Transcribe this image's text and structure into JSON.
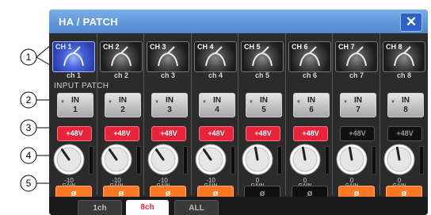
{
  "window": {
    "title": "HA / PATCH",
    "close_label": "✕"
  },
  "section_label": "INPUT PATCH",
  "callouts": [
    "1",
    "2",
    "3",
    "4",
    "5"
  ],
  "channels": [
    {
      "name": "CH 1",
      "sub": "ch 1",
      "patch_top": "IN",
      "patch_bottom": "1",
      "phantom": "+48V",
      "phantom_on": true,
      "gain": "-10",
      "gain_label": "GAIN",
      "phase": "ø",
      "phase_on": true,
      "selected": true
    },
    {
      "name": "CH 2",
      "sub": "ch 2",
      "patch_top": "IN",
      "patch_bottom": "2",
      "phantom": "+48V",
      "phantom_on": true,
      "gain": "-10",
      "gain_label": "GAIN",
      "phase": "ø",
      "phase_on": true,
      "selected": false
    },
    {
      "name": "CH 3",
      "sub": "ch 3",
      "patch_top": "IN",
      "patch_bottom": "3",
      "phantom": "+48V",
      "phantom_on": true,
      "gain": "-10",
      "gain_label": "GAIN",
      "phase": "ø",
      "phase_on": true,
      "selected": false
    },
    {
      "name": "CH 4",
      "sub": "ch 4",
      "patch_top": "IN",
      "patch_bottom": "4",
      "phantom": "+48V",
      "phantom_on": true,
      "gain": "-10",
      "gain_label": "GAIN",
      "phase": "ø",
      "phase_on": true,
      "selected": false
    },
    {
      "name": "CH 5",
      "sub": "ch 5",
      "patch_top": "IN",
      "patch_bottom": "5",
      "phantom": "+48V",
      "phantom_on": true,
      "gain": "0",
      "gain_label": "GAIN",
      "phase": "ø",
      "phase_on": false,
      "selected": false
    },
    {
      "name": "CH 6",
      "sub": "ch 6",
      "patch_top": "IN",
      "patch_bottom": "6",
      "phantom": "+48V",
      "phantom_on": true,
      "gain": "0",
      "gain_label": "GAIN",
      "phase": "ø",
      "phase_on": false,
      "selected": false
    },
    {
      "name": "CH 7",
      "sub": "ch 7",
      "patch_top": "IN",
      "patch_bottom": "7",
      "phantom": "+48V",
      "phantom_on": false,
      "gain": "0",
      "gain_label": "GAIN",
      "phase": "ø",
      "phase_on": true,
      "selected": false
    },
    {
      "name": "CH 8",
      "sub": "ch 8",
      "patch_top": "IN",
      "patch_bottom": "8",
      "phantom": "+48V",
      "phantom_on": false,
      "gain": "0",
      "gain_label": "GAIN",
      "phase": "ø",
      "phase_on": true,
      "selected": false
    }
  ],
  "tabs": [
    {
      "label": "1ch",
      "active": false
    },
    {
      "label": "8ch",
      "active": true
    },
    {
      "label": "ALL",
      "active": false
    }
  ],
  "colors": {
    "phantom_on": "#e8243a",
    "phase_on": "#ff7722",
    "title_bar": "#5b8fd6",
    "selected_channel": "#3f5bd6"
  }
}
